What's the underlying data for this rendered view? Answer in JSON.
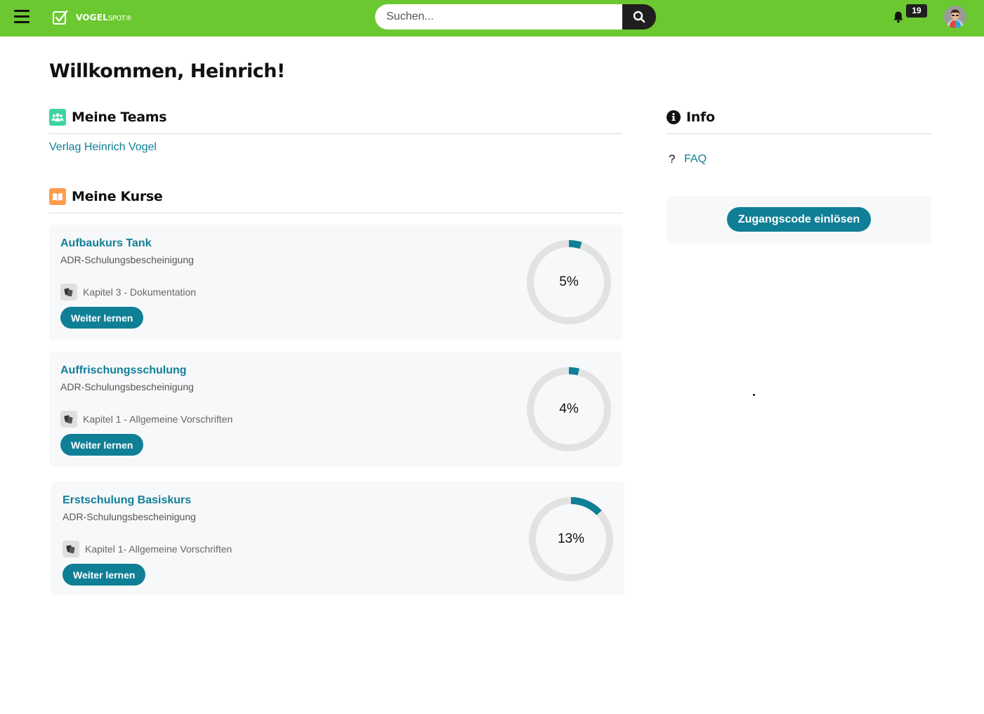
{
  "header": {
    "logo_bold": "VOGEL",
    "logo_light": "SPOT",
    "logo_mark": "®",
    "search_placeholder": "Suchen...",
    "notification_count": "19",
    "colors": {
      "bar": "#6bc831",
      "accent": "#0f7f96"
    }
  },
  "welcome": "Willkommen, Heinrich!",
  "teams": {
    "title": "Meine Teams",
    "icon": "users-icon",
    "items": [
      {
        "label": "Verlag Heinrich Vogel"
      }
    ]
  },
  "courses": {
    "title": "Meine Kurse",
    "icon": "book-icon",
    "items": [
      {
        "title": "Aufbaukurs Tank",
        "subtitle": "ADR-Schulungsbescheinigung",
        "chapter": "Kapitel 3 - Dokumentation",
        "button": "Weiter lernen",
        "progress": 5,
        "progress_label": "5%"
      },
      {
        "title": "Auffrischungsschulung",
        "subtitle": "ADR-Schulungsbescheinigung",
        "chapter": "Kapitel 1 - Allgemeine Vorschriften",
        "button": "Weiter lernen",
        "progress": 4,
        "progress_label": "4%"
      },
      {
        "title": "Erstschulung Basiskurs",
        "subtitle": "ADR-Schulungsbescheinigung",
        "chapter": "Kapitel 1- Allgemeine Vorschriften",
        "button": "Weiter lernen",
        "progress": 13,
        "progress_label": "13%"
      }
    ]
  },
  "info": {
    "title": "Info",
    "faq_symbol": "?",
    "faq_label": "FAQ",
    "code_button": "Zugangscode einlösen"
  }
}
